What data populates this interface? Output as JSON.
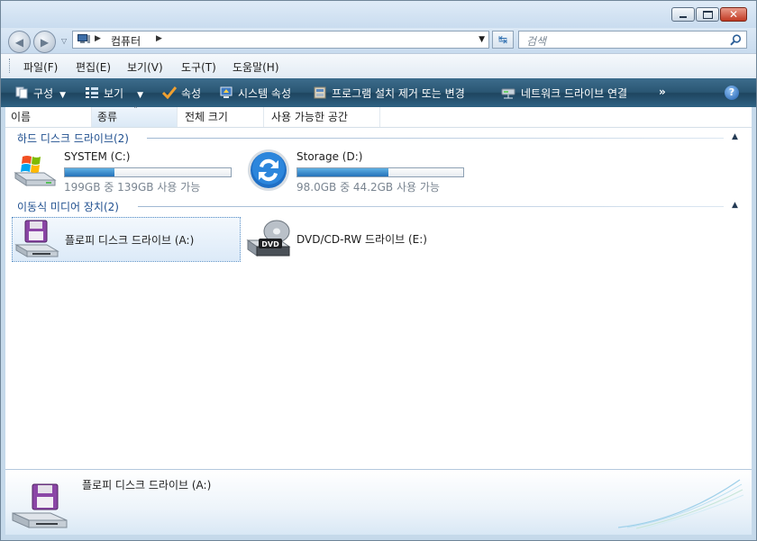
{
  "address": {
    "location": "컴퓨터"
  },
  "search": {
    "placeholder": "검색"
  },
  "menu": [
    "파일(F)",
    "편집(E)",
    "보기(V)",
    "도구(T)",
    "도움말(H)"
  ],
  "commands": {
    "organize": "구성",
    "views": "보기",
    "properties": "속성",
    "system_properties": "시스템 속성",
    "uninstall": "프로그램 설치 제거 또는 변경",
    "map_drive": "네트워크 드라이브 연결",
    "more": "»",
    "help": "?"
  },
  "columns": [
    "이름",
    "종류",
    "전체 크기",
    "사용 가능한 공간"
  ],
  "sort_arrow": "ˆ",
  "groups": {
    "hard_disks": {
      "title": "하드 디스크 드라이브(2)",
      "drives": [
        {
          "name": "SYSTEM (C:)",
          "info": "199GB 중 139GB 사용 가능",
          "used_fraction": 0.3,
          "icon": "windows-drive-icon"
        },
        {
          "name": "Storage (D:)",
          "info": "98.0GB 중 44.2GB 사용 가능",
          "used_fraction": 0.55,
          "icon": "sync-drive-icon"
        }
      ]
    },
    "removable": {
      "title": "이동식 미디어 장치(2)",
      "drives": [
        {
          "name": "플로피 디스크 드라이브 (A:)",
          "icon": "floppy-drive-icon"
        },
        {
          "name": "DVD/CD-RW 드라이브 (E:)",
          "icon": "dvd-drive-icon",
          "badge": "DVD"
        }
      ]
    }
  },
  "details": {
    "name": "플로피 디스크 드라이브 (A:)"
  },
  "colors": {
    "group_title": "#1f4f8f",
    "command_bar": "#2a5673",
    "bar_fill": "#2471b9",
    "selection": "#dceaf8"
  }
}
